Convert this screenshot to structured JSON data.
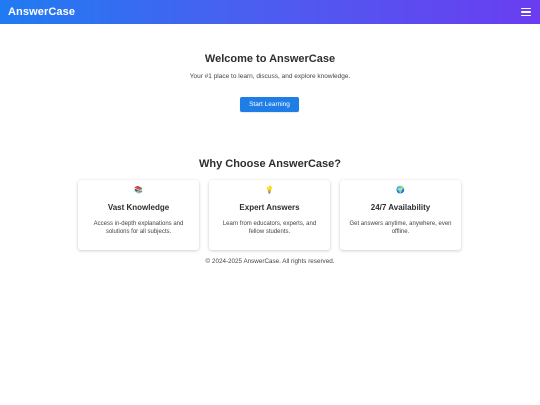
{
  "navbar": {
    "brand": "AnswerCase",
    "menu_icon": "hamburger-menu-icon",
    "gradient_colors": [
      "#1f7bf2",
      "#6a3df0"
    ]
  },
  "hero": {
    "title": "Welcome to AnswerCase",
    "subtitle": "Your #1 place to learn, discuss, and explore knowledge.",
    "cta_label": "Start Learning",
    "cta_color": "#1f7de6"
  },
  "features": {
    "heading": "Why Choose AnswerCase?",
    "cards": [
      {
        "icon": "books-icon",
        "glyph": "📚",
        "title": "Vast Knowledge",
        "description": "Access in-depth explanations and solutions for all subjects."
      },
      {
        "icon": "lightbulb-icon",
        "glyph": "💡",
        "title": "Expert Answers",
        "description": "Learn from educators, experts, and fellow students."
      },
      {
        "icon": "globe-icon",
        "glyph": "🌍",
        "title": "24/7 Availability",
        "description": "Get answers anytime, anywhere, even offline."
      }
    ]
  },
  "footer": {
    "text": "© 2024-2025 AnswerCase. All rights reserved."
  }
}
